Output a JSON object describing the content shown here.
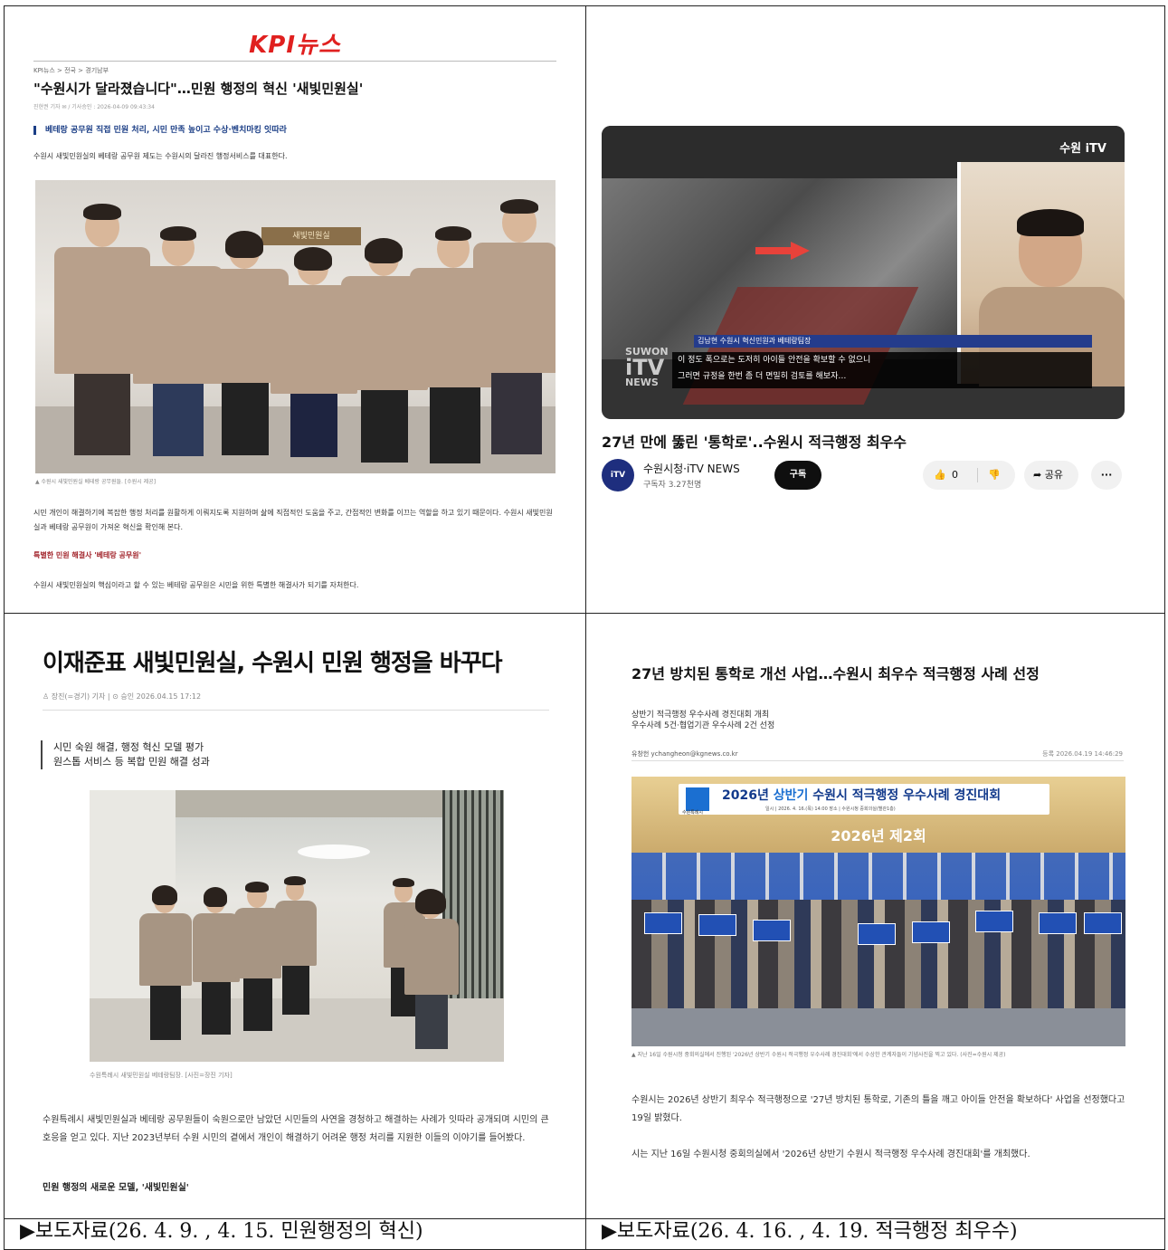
{
  "cell1": {
    "logo": "KPI뉴스",
    "breadcrumb": "KPI뉴스 > 전국 > 경기남부",
    "title": "\"수원시가 달라졌습니다\"…민원 행정의 혁신 '새빛민원실'",
    "meta": "진현권 기자 ✉ / 기사승인 : 2026-04-09 09:43:34",
    "subhead": "베테랑 공무원 직접 민원 처리, 시민 만족 높이고 수상·벤치마킹 잇따라",
    "lead": "수원시 새빛민원실의 베테랑 공무원 제도는 수원시의 달라진 행정서비스를 대표한다.",
    "photo_sign": "새빛민원실",
    "caption": "▲ 수원시 새빛민원실 베테랑 공무원들. [수원시 제공]",
    "body": "시민 개인이 해결하기에 복잡한 행정 처리를 원활하게 이뤄지도록 지원하며 삶에 직접적인 도움을 주고, 간접적인 변화를 이끄는 역할을 하고 있기 때문이다. 수원시 새빛민원실과 베테랑 공무원이 가져온 혁신을 확인해 본다.",
    "red_sub": "특별한 민원 해결사 '베테랑 공무원'",
    "body2": "수원시 새빛민원실의 핵심이라고 할 수 있는 베테랑 공무원은 시민을 위한 특별한 해결사가 되기를 자처한다."
  },
  "cell2": {
    "video": {
      "brand": "수원 iTV",
      "lower_name": "김남현 수원시 혁신민원과 베테랑팀장",
      "lower_line1": "이 정도 폭으로는 도저히 아이들 안전을 확보할 수 없으니",
      "lower_line2": "그러면 규정을 한번 좀 더 면밀히 검토를 해보자…",
      "watermark_top": "SUWON",
      "watermark_main": "iTV",
      "watermark_bottom": "NEWS"
    },
    "title": "27년 만에 뚫린 '통학로'..수원시 적극행정 최우수",
    "channel": {
      "avatar_text": "iTV",
      "name": "수원시청·iTV NEWS",
      "subscribers": "구독자 3.27천명",
      "subscribe_label": "구독"
    },
    "actions": {
      "like_icon": "thumbs-up-icon",
      "like_glyph": "👍",
      "like_count": "0",
      "dislike_icon": "thumbs-down-icon",
      "dislike_glyph": "👎",
      "share_glyph": "➦",
      "share_label": "공유",
      "more_glyph": "···"
    }
  },
  "cell3": {
    "headline": "이재준표 새빛민원실, 수원시 민원 행정을 바꾸다",
    "meta": "♙ 장진(=경기) 기자  |  ⊙ 승인 2026.04.15 17:12",
    "sub_line1": "시민 숙원 해결, 행정 혁신 모델 평가",
    "sub_line2": "원스톱 서비스 등 복합 민원 해결 성과",
    "caption": "수원특례시 새빛민원실 베테랑팀장. [사진=장진 기자]",
    "body": "수원특례시 새빛민원실과 베테랑 공무원들이 숙원으로만 남았던 시민들의 사연을 경청하고 해결하는 사례가 잇따라 공개되며 시민의 큰 호응을 얻고 있다. 지난 2023년부터 수원 시민의 곁에서 개인이 해결하기 어려운 행정 처리를 지원한 이들의 이야기를 들어봤다.",
    "bold_sub": "민원 행정의 새로운 모델, '새빛민원실'"
  },
  "cell4": {
    "headline": "27년 방치된 통학로 개선 사업…수원시 최우수 적극행정 사례 선정",
    "sub_line1": "상반기 적극행정 우수사례 경진대회 개최",
    "sub_line2": "우수사례 5건·협업기관 우수사례 2건 선정",
    "author": "유창헌  ychangheon@kgnews.co.kr",
    "date": "등록 2026.04.19 14:46:29",
    "event_title_year": "2026년",
    "event_title_highlight": "상반기",
    "event_title_rest": "수원시 적극행정 우수사례 경진대회",
    "event_info": "일시 | 2026. 4. 16.(목) 14:00    장소 | 수원시청 중회의실(별관1층)",
    "event_org": "수원특례시",
    "event_round": "2026년 제2회",
    "caption": "▲ 지난 16일 수원시청 중회의실에서 진행된 '2026년 상반기 수원시 적극행정 우수사례 경진대회'에서 수상한 관계자들이 기념사진을 찍고 있다. (사진=수원시 제공)",
    "body1": "수원시는 2026년 상반기 최우수 적극행정으로 '27년 방치된 통학로, 기존의 틀을 깨고 아이들 안전을 확보하다' 사업을 선정했다고 19일 밝혔다.",
    "body2": "시는 지난 16일 수원시청 중회의실에서 '2026년 상반기 수원시 적극행정 우수사례 경진대회'를 개최했다."
  },
  "footer": {
    "left": "▶보도자료(26. 4. 9. , 4. 15. 민원행정의 혁신)",
    "right": "▶보도자료(26. 4. 16. , 4. 19. 적극행정 최우수)"
  }
}
